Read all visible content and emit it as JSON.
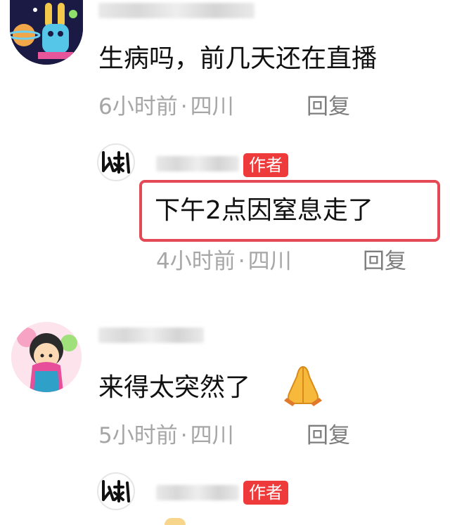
{
  "comments": [
    {
      "text": "生病吗，前几天还在直播",
      "time": "6小时前",
      "location": "四川",
      "separator": "·",
      "reply_label": "回复",
      "reply": {
        "badge": "作者",
        "text": "下午2点因窒息走了",
        "time": "4小时前",
        "location": "四川",
        "separator": "·",
        "reply_label": "回复"
      }
    },
    {
      "text": "来得太突然了",
      "time": "5小时前",
      "location": "四川",
      "separator": "·",
      "reply_label": "回复",
      "reply": {
        "badge": "作者"
      }
    }
  ],
  "colors": {
    "badge": "#ee3a3a",
    "highlight_border": "#e34a55",
    "meta_text": "#a6a6a6",
    "reply_text": "#7d7d7d"
  },
  "icons": {
    "author_avatar": "glyph-logo-avatar",
    "emoji": "folded-hands-icon"
  }
}
